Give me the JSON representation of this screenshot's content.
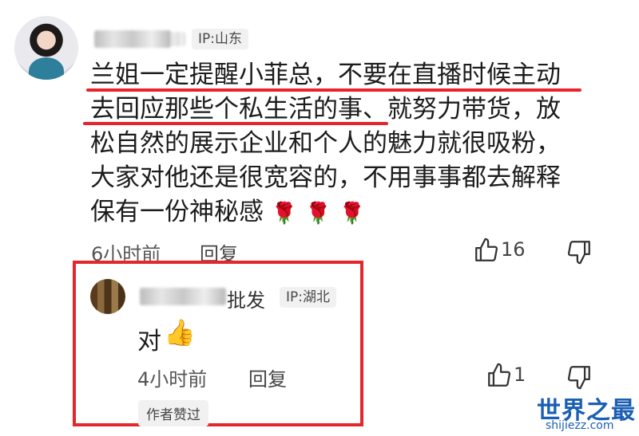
{
  "comment": {
    "ip_label": "IP:山东",
    "lines": [
      "兰姐一定提醒小菲总，不要在直播时候主动",
      "去回应那些个私生活的事、就努力带货，放",
      "松自然的展示企业和个人的魅力就很吸粉，",
      "大家对他还是很宽容的，不用事事都去解释",
      "保有一份神秘感"
    ],
    "emoji": "🌹🌹🌹",
    "time": "6小时前",
    "reply_label": "回复",
    "like_count": "16"
  },
  "reply": {
    "name_suffix": "批发",
    "ip_label": "IP:湖北",
    "text": "对",
    "emoji": "👍",
    "time": "4小时前",
    "reply_label": "回复",
    "like_count": "1",
    "author_badge": "作者赞过"
  },
  "watermark": {
    "title": "世界之最",
    "url": "shijiezz.com"
  },
  "colors": {
    "highlight": "#e6262d",
    "watermark": "#1a5fb4"
  }
}
